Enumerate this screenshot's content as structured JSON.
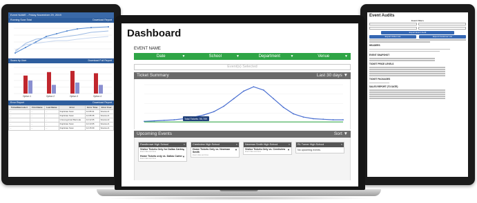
{
  "left_tablet": {
    "header_title": "Event NAME - Friday November 29, 2019",
    "panel1_title": "Running Scan Total",
    "panel1_action": "Download Report",
    "panel2_title": "Scans by User",
    "panel2_action": "Download Full Report",
    "panel3_title": "Error Report",
    "panel3_action": "Download Report",
    "bar_labels": [
      "Option 1",
      "Option 2",
      "Option 3",
      "Option 4"
    ],
    "bar_values": [
      [
        62,
        45
      ],
      [
        74,
        30
      ],
      [
        78,
        38
      ],
      [
        70,
        30
      ]
    ],
    "error_columns": [
      "Ticket/Barcode #",
      "First Name",
      "Last Name",
      "Error",
      "Error Time",
      "Error User"
    ],
    "error_rows": [
      [
        "...",
        "...",
        "...",
        "Duplicate Scan",
        "12:05:31",
        "Scanner1"
      ],
      [
        "...",
        "...",
        "...",
        "Duplicate Scan",
        "12:05:35",
        "Scanner1"
      ],
      [
        "...",
        "...",
        "...",
        "Unrecognized Barcode",
        "12:12:05",
        "Scanner2"
      ],
      [
        "...",
        "...",
        "...",
        "Duplicate Scan",
        "12:13:05",
        "Scanner1"
      ],
      [
        "...",
        "...",
        "...",
        "Duplicate Scan",
        "12:15:09",
        "Scanner1"
      ]
    ]
  },
  "right_tablet": {
    "title": "Event Audits",
    "filters_label": "Event Filters",
    "export_button": "Export Event Audit",
    "export_csv_button": "Export Order List",
    "export_customer_button": "Export Customer List",
    "sections": [
      "HEADERS",
      "EVENT SNAPSHOT",
      "TICKET PRICE LEVELS",
      "TICKET PACKAGES",
      "SALES REPORT (TO DATE)"
    ]
  },
  "dashboard": {
    "title": "Dashboard",
    "event_name_label": "EVENT NAME",
    "filters": [
      {
        "label": "Date"
      },
      {
        "label": "School"
      },
      {
        "label": "Department"
      },
      {
        "label": "Venue"
      }
    ],
    "events_selected": "Event(s) Selected",
    "ticket_summary": {
      "title": "Ticket Summary",
      "range": "Last 30 days",
      "tooltip": "Total Tickets: 56,789"
    },
    "upcoming": {
      "title": "Upcoming Events",
      "sort_label": "Sort",
      "cards": [
        {
          "school": "Randhrowe High School",
          "items": [
            {
              "title": "Visitor Tickets Only for Dallas Carter",
              "sub": "Event date and time"
            },
            {
              "title": "Home Tickets only vs. Dallas Carter",
              "sub": "Event date and time"
            }
          ]
        },
        {
          "school": "Creekview High School",
          "items": [
            {
              "title": "Home Tickets Only vs. Newman Smith",
              "sub": "Event date and time"
            }
          ]
        },
        {
          "school": "Newman Smith High School",
          "items": [
            {
              "title": "Visitor Tickets Only vs. Creekview",
              "sub": "Event date and time"
            }
          ]
        },
        {
          "school": "RL Turner High School",
          "empty": "No upcoming events."
        }
      ]
    }
  },
  "chart_data": {
    "type": "line",
    "series": [
      {
        "name": "",
        "color": "#4a6fd1",
        "values": [
          2,
          3,
          4,
          5,
          7,
          10,
          14,
          20,
          30,
          44,
          58,
          66,
          60,
          44,
          28,
          16,
          10,
          7,
          6,
          5,
          5
        ]
      },
      {
        "name": "",
        "color": "#3caf50",
        "values": [
          1,
          1,
          1,
          1,
          1,
          1,
          1,
          1,
          1,
          1,
          1,
          1,
          1,
          1,
          1,
          1,
          1,
          1,
          1,
          1,
          1
        ]
      }
    ]
  },
  "colors": {
    "filter_green": "#2fa546",
    "panel_grey": "#6b6b6b",
    "tablet_blue": "#2e5e9e"
  }
}
